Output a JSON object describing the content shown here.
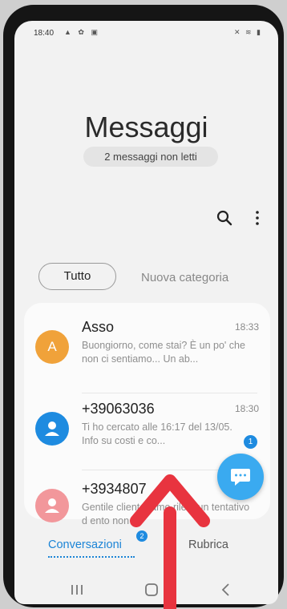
{
  "status_bar": {
    "time": "18:40",
    "left_icons": "▲ ✿ ▣",
    "right_icons": "✕ ≋ ▮"
  },
  "header": {
    "title": "Messaggi",
    "unread": "2 messaggi non letti"
  },
  "toolbar": {
    "search_icon": "search-icon",
    "more_icon": "more-vertical-icon"
  },
  "filters": {
    "all": "Tutto",
    "new_category": "Nuova categoria"
  },
  "conversations": [
    {
      "avatar": "A",
      "avatar_color": "#f0a23a",
      "name": "Asso",
      "time": "18:33",
      "preview": "Buongiorno,  come stai? È un po' che non ci sentiamo... Un ab..."
    },
    {
      "avatar": "person-icon",
      "avatar_color": "#1e8be0",
      "name": "+39063036",
      "time": "18:30",
      "preview": "Ti ho cercato alle 16:17 del 13/05. Info su costi e co...",
      "unread_count": "1"
    },
    {
      "avatar": "person-icon",
      "avatar_color": "#f2979b",
      "name": "+3934807",
      "time": "",
      "preview": "Gentile cliente,          amo rile...    un tentativo d          ento non ..."
    }
  ],
  "bottom_tabs": {
    "conversations": "Conversazioni",
    "conversations_badge": "2",
    "contacts": "Rubrica"
  },
  "nav": {
    "recents": "recents-icon",
    "home": "home-icon",
    "back": "back-icon"
  },
  "colors": {
    "accent": "#1b84d6",
    "fab": "#3aaaf0",
    "arrow": "#e8343f"
  }
}
